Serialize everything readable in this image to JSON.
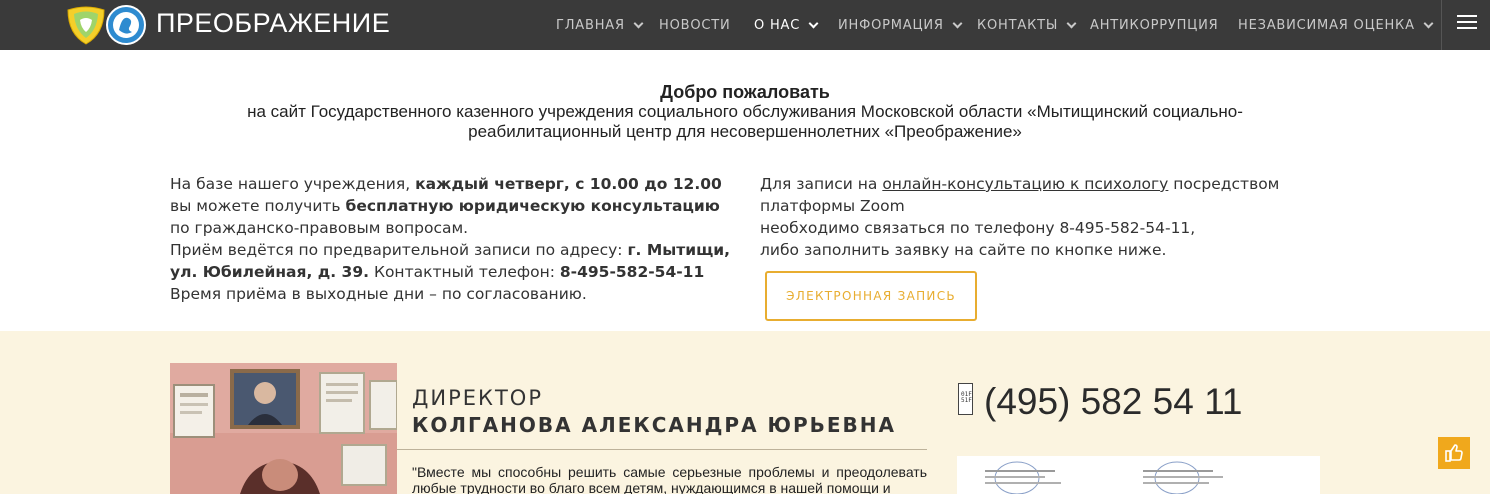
{
  "header": {
    "brand": "ПРЕОБРАЖЕНИЕ",
    "nav": [
      {
        "label": "ГЛАВНАЯ",
        "dropdown": true
      },
      {
        "label": "НОВОСТИ",
        "dropdown": false
      },
      {
        "label": "О НАС",
        "dropdown": true,
        "active": true
      },
      {
        "label": "ИНФОРМАЦИЯ",
        "dropdown": true
      },
      {
        "label": "КОНТАКТЫ",
        "dropdown": true
      },
      {
        "label": "АНТИКОРРУПЦИЯ",
        "dropdown": false
      },
      {
        "label": "НЕЗАВИСИМАЯ ОЦЕНКА",
        "dropdown": true
      }
    ],
    "menu_icon": "hamburger-menu-icon",
    "colors": {
      "bar": "#3a3a3a",
      "text": "#c9c9c9",
      "active": "#ffffff"
    }
  },
  "welcome": {
    "title": "Добро пожаловать",
    "subtitle": "на сайт Государственного казенного учреждения социального обслуживания Московской области «Мытищинский социально-реабилитационный центр для несовершеннолетних «Преображение»"
  },
  "legal": {
    "p1_a": "На базе нашего учреждения, ",
    "p1_b": "каждый четверг, с 10.00 до 12.00",
    "p1_c": " вы можете получить ",
    "p1_d": "бесплатную юридическую консультацию",
    "p1_e": " по гражданско-правовым вопросам.",
    "p2_a": "Приём ведётся по предварительной записи по адресу: ",
    "p2_b": "г. Мытищи, ул. Юбилейная, д. 39.",
    "p2_c": " Контактный телефон: ",
    "p2_d": "8-495-582-54-11",
    "p3": "Время приёма в выходные дни – по согласованию."
  },
  "online": {
    "line1_a": "Для записи на ",
    "line1_link": "онлайн-консультацию к психологу",
    "line1_b": " посредством платформы Zoom",
    "line2": "необходимо связаться по телефону 8-495-582-54-11,",
    "line3": "либо заполнить заявку на сайте по кнопке ниже.",
    "button": "ЭЛЕКТРОННАЯ ЗАПИСЬ",
    "accent": "#e8ad30"
  },
  "director": {
    "role": "ДИРЕКТОР",
    "name": "КОЛГАНОВА АЛЕКСАНДРА ЮРЬЕВНА",
    "quote": "\"Вместе мы способны решить самые серьезные проблемы и преодолевать любые трудности во благо всем детям, нуждающимся в нашей помощи и"
  },
  "contact": {
    "phone": "(495) 582 54 11",
    "icon": "phone-icon",
    "like_icon": "thumbs-up-icon"
  },
  "section_bg": "#fbf4e0"
}
